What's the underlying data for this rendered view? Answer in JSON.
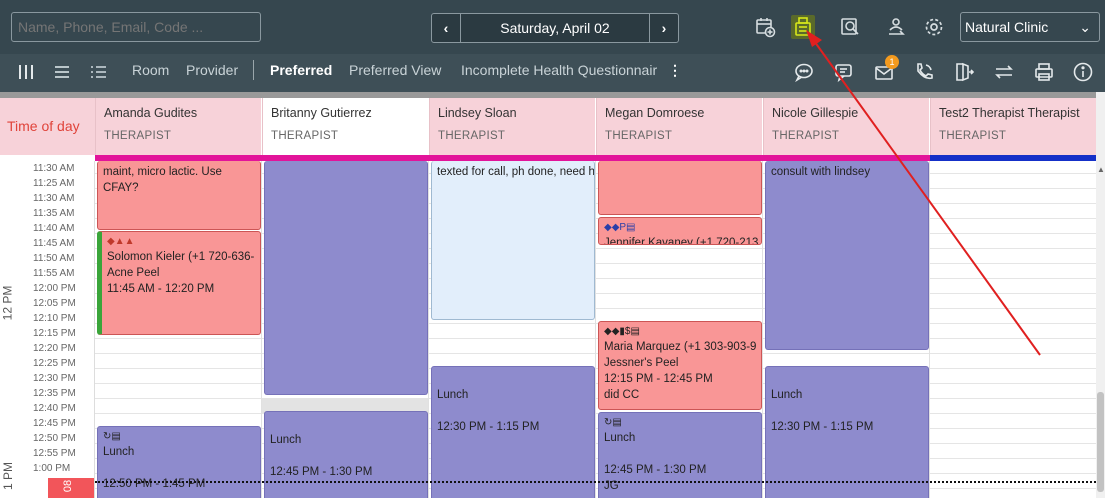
{
  "search": {
    "placeholder": "Name, Phone, Email, Code ..."
  },
  "datenav": {
    "prev": "‹",
    "date": "Saturday, April 02",
    "next": "›"
  },
  "topicons": [
    "calendar-add-icon",
    "cash-register-icon",
    "search-document-icon",
    "user-switch-icon",
    "gear-icon"
  ],
  "clinic": {
    "value": "Natural Clinic"
  },
  "toolbar": {
    "room": "Room",
    "provider": "Provider",
    "preferred": "Preferred",
    "preferred_view": "Preferred View",
    "incomplete": "Incomplete Health Questionnair",
    "notif_badge": "1"
  },
  "time_header": "Time of day",
  "columns": [
    {
      "name": "Amanda Gudites",
      "type": "THERAPIST",
      "line": "#e2149a"
    },
    {
      "name": "Britanny Gutierrez",
      "type": "THERAPIST",
      "line": "#e2149a"
    },
    {
      "name": "Lindsey Sloan",
      "type": "THERAPIST",
      "line": "#e2149a"
    },
    {
      "name": "Megan Domroese",
      "type": "THERAPIST",
      "line": "#e2149a"
    },
    {
      "name": "Nicole Gillespie",
      "type": "THERAPIST",
      "line": "#e2149a"
    },
    {
      "name": "Test2 Therapist Therapist",
      "type": "THERAPIST",
      "line": "#1530c8"
    }
  ],
  "times": [
    "11:30 AM",
    "11:25 AM",
    "11:30 AM",
    "11:35 AM",
    "11:40 AM",
    "11:45 AM",
    "11:50 AM",
    "11:55 AM",
    "12:00 PM",
    "12:05 PM",
    "12:10 PM",
    "12:15 PM",
    "12:20 PM",
    "12:25 PM",
    "12:30 PM",
    "12:35 PM",
    "12:40 PM",
    "12:45 PM",
    "12:50 PM",
    "12:55 PM",
    "1:00 PM"
  ],
  "hour_labels": {
    "h12": "12 PM",
    "h1": "1 PM"
  },
  "appointments": {
    "a1": {
      "note": "maint, micro lactic. Use CFAY?"
    },
    "a2": {
      "glyphs": "◆▲▲",
      "name": "Solomon Kieler (+1 720-636-",
      "service": "Acne Peel",
      "time": "11:45 AM - 12:20 PM"
    },
    "a3": {
      "glyphs": "↻▤",
      "title": "Lunch",
      "time": "12:50 PM - 1:45 PM"
    },
    "b2": {
      "title": "Lunch",
      "time": "12:45 PM - 1:30 PM"
    },
    "c1": {
      "note": "texted for call, ph done, need h"
    },
    "c2": {
      "title": "Lunch",
      "time": "12:30 PM - 1:15 PM"
    },
    "d2": {
      "glyphs": "◆◆P▤",
      "name": "Jennifer Kavaney (+1 720-213"
    },
    "d3": {
      "glyphs": "◆◆▮$▤",
      "name": "Maria Marquez (+1 303-903-9",
      "service": "Jessner's Peel",
      "time": "12:15 PM - 12:45 PM",
      "note": "did CC"
    },
    "d4": {
      "glyphs": "↻▤",
      "title": "Lunch",
      "time": "12:45 PM - 1:30 PM",
      "note": "JG"
    },
    "e1": {
      "note": "consult with lindsey"
    },
    "e2": {
      "title": "Lunch",
      "time": "12:30 PM - 1:15 PM"
    }
  },
  "redtab": "08",
  "colors": {
    "topbar": "#36474f",
    "toolbar": "#3e4f57",
    "header_pink": "#f7d2d9",
    "appt_red": "#f99696",
    "appt_purple": "#8e8bcd",
    "appt_light": "#e2eefb",
    "arrow": "#e02020"
  }
}
